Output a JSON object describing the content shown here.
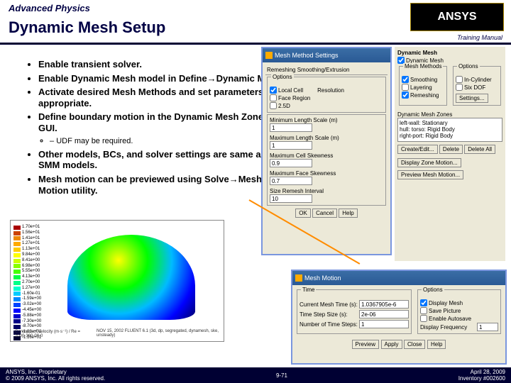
{
  "header": {
    "subtitle": "Advanced Physics",
    "title": "Dynamic Mesh Setup",
    "logo": "ANSYS",
    "tm": "Training Manual"
  },
  "bullets": {
    "b1": "Enable transient solver.",
    "b2": "Enable Dynamic Mesh model in Define→Dynamic Mesh.",
    "b3": "Activate desired Mesh Methods and set parameters as appropriate.",
    "b4": "Define boundary motion in the Dynamic Mesh Zones GUI.",
    "b4s": "UDF may be required.",
    "b5": "Other models, BCs, and solver settings are same as SMM models.",
    "b6": "Mesh motion can be previewed using Solve→Mesh Motion utility."
  },
  "legend": [
    "1.70e+01",
    "1.56e+01",
    "1.41e+01",
    "1.27e+01",
    "1.13e+01",
    "9.84e+00",
    "8.41e+00",
    "6.98e+00",
    "5.55e+00",
    "4.13e+00",
    "2.70e+00",
    "1.27e+00",
    "-1.60e-01",
    "-1.59e+00",
    "-3.02e+00",
    "-4.45e+00",
    "-5.88e+00",
    "-7.30e+00",
    "-8.70e+00",
    "-1.02e+01",
    "-1.16e+01"
  ],
  "legcolors": [
    "#a00",
    "#c40",
    "#e80",
    "#fa0",
    "#fc0",
    "#ff0",
    "#cf0",
    "#8f0",
    "#4f0",
    "#0f4",
    "#0f8",
    "#0fc",
    "#0cf",
    "#08f",
    "#04f",
    "#00f",
    "#00c",
    "#008",
    "#006",
    "#004",
    "#003"
  ],
  "cfd": {
    "left": "Contours of Velocity (m·s⁻¹) / Re = 2000·360·00·0",
    "right": "NOV 15, 2002\nFLUENT 6.1 (3d, dp, segregated, dynamesh, ske, unsteady)"
  },
  "win1": {
    "title": "Mesh Method Settings",
    "tab": "Remeshing Smoothing/Extrusion",
    "loc": "Local Cell",
    "face": "Face Region",
    "zon": "2.5D",
    "res": "Resolution",
    "minlen": "Minimum Length Scale (m)",
    "minlenv": "1",
    "maxlen": "Maximum Length Scale (m)",
    "maxlenv": "1",
    "maxskew": "Maximum Cell Skewness",
    "maxskewv": "0.9",
    "facemax": "Maximum Face Skewness",
    "facemaxv": "0.7",
    "sizerem": "Size Remesh Interval",
    "sizeremv": "10",
    "ok": "OK",
    "cancel": "Cancel",
    "help": "Help"
  },
  "win2": {
    "title": "Dynamic Mesh",
    "dm": "Dynamic Mesh",
    "mm": "Mesh Methods",
    "smooth": "Smoothing",
    "layer": "Layering",
    "remesh": "Remeshing",
    "opts": "Options",
    "incyl": "In-Cylinder",
    "sixd": "Six DOF",
    "settings": "Settings...",
    "zones": "Dynamic Mesh Zones",
    "z1": "left-wall: Stationary",
    "z2": "hull: torso: Rigid Body",
    "z3": "right-port: Rigid Body",
    "create": "Create/Edit...",
    "delete": "Delete",
    "delall": "Delete All",
    "display": "Display Zone Motion...",
    "preview": "Preview Mesh Motion..."
  },
  "win3": {
    "title": "Mesh Motion",
    "time": "Time",
    "cmt": "Current Mesh Time (s):",
    "cmtv": "1.0367905e-6",
    "tss": "Time Step Size (s):",
    "tssv": "2e-06",
    "nts": "Number of Time Steps:",
    "ntsv": "1",
    "opts": "Options",
    "dmesh": "Display Mesh",
    "spic": "Save Picture",
    "eauto": "Enable Autosave",
    "dfreq": "Display Frequency",
    "dfreqv": "1",
    "preview": "Preview",
    "apply": "Apply",
    "close": "Close",
    "help": "Help"
  },
  "footer": {
    "l1": "ANSYS, Inc. Proprietary",
    "l2": "© 2009 ANSYS, Inc. All rights reserved.",
    "c": "9-71",
    "r1": "April 28, 2009",
    "r2": "Inventory #002600"
  }
}
